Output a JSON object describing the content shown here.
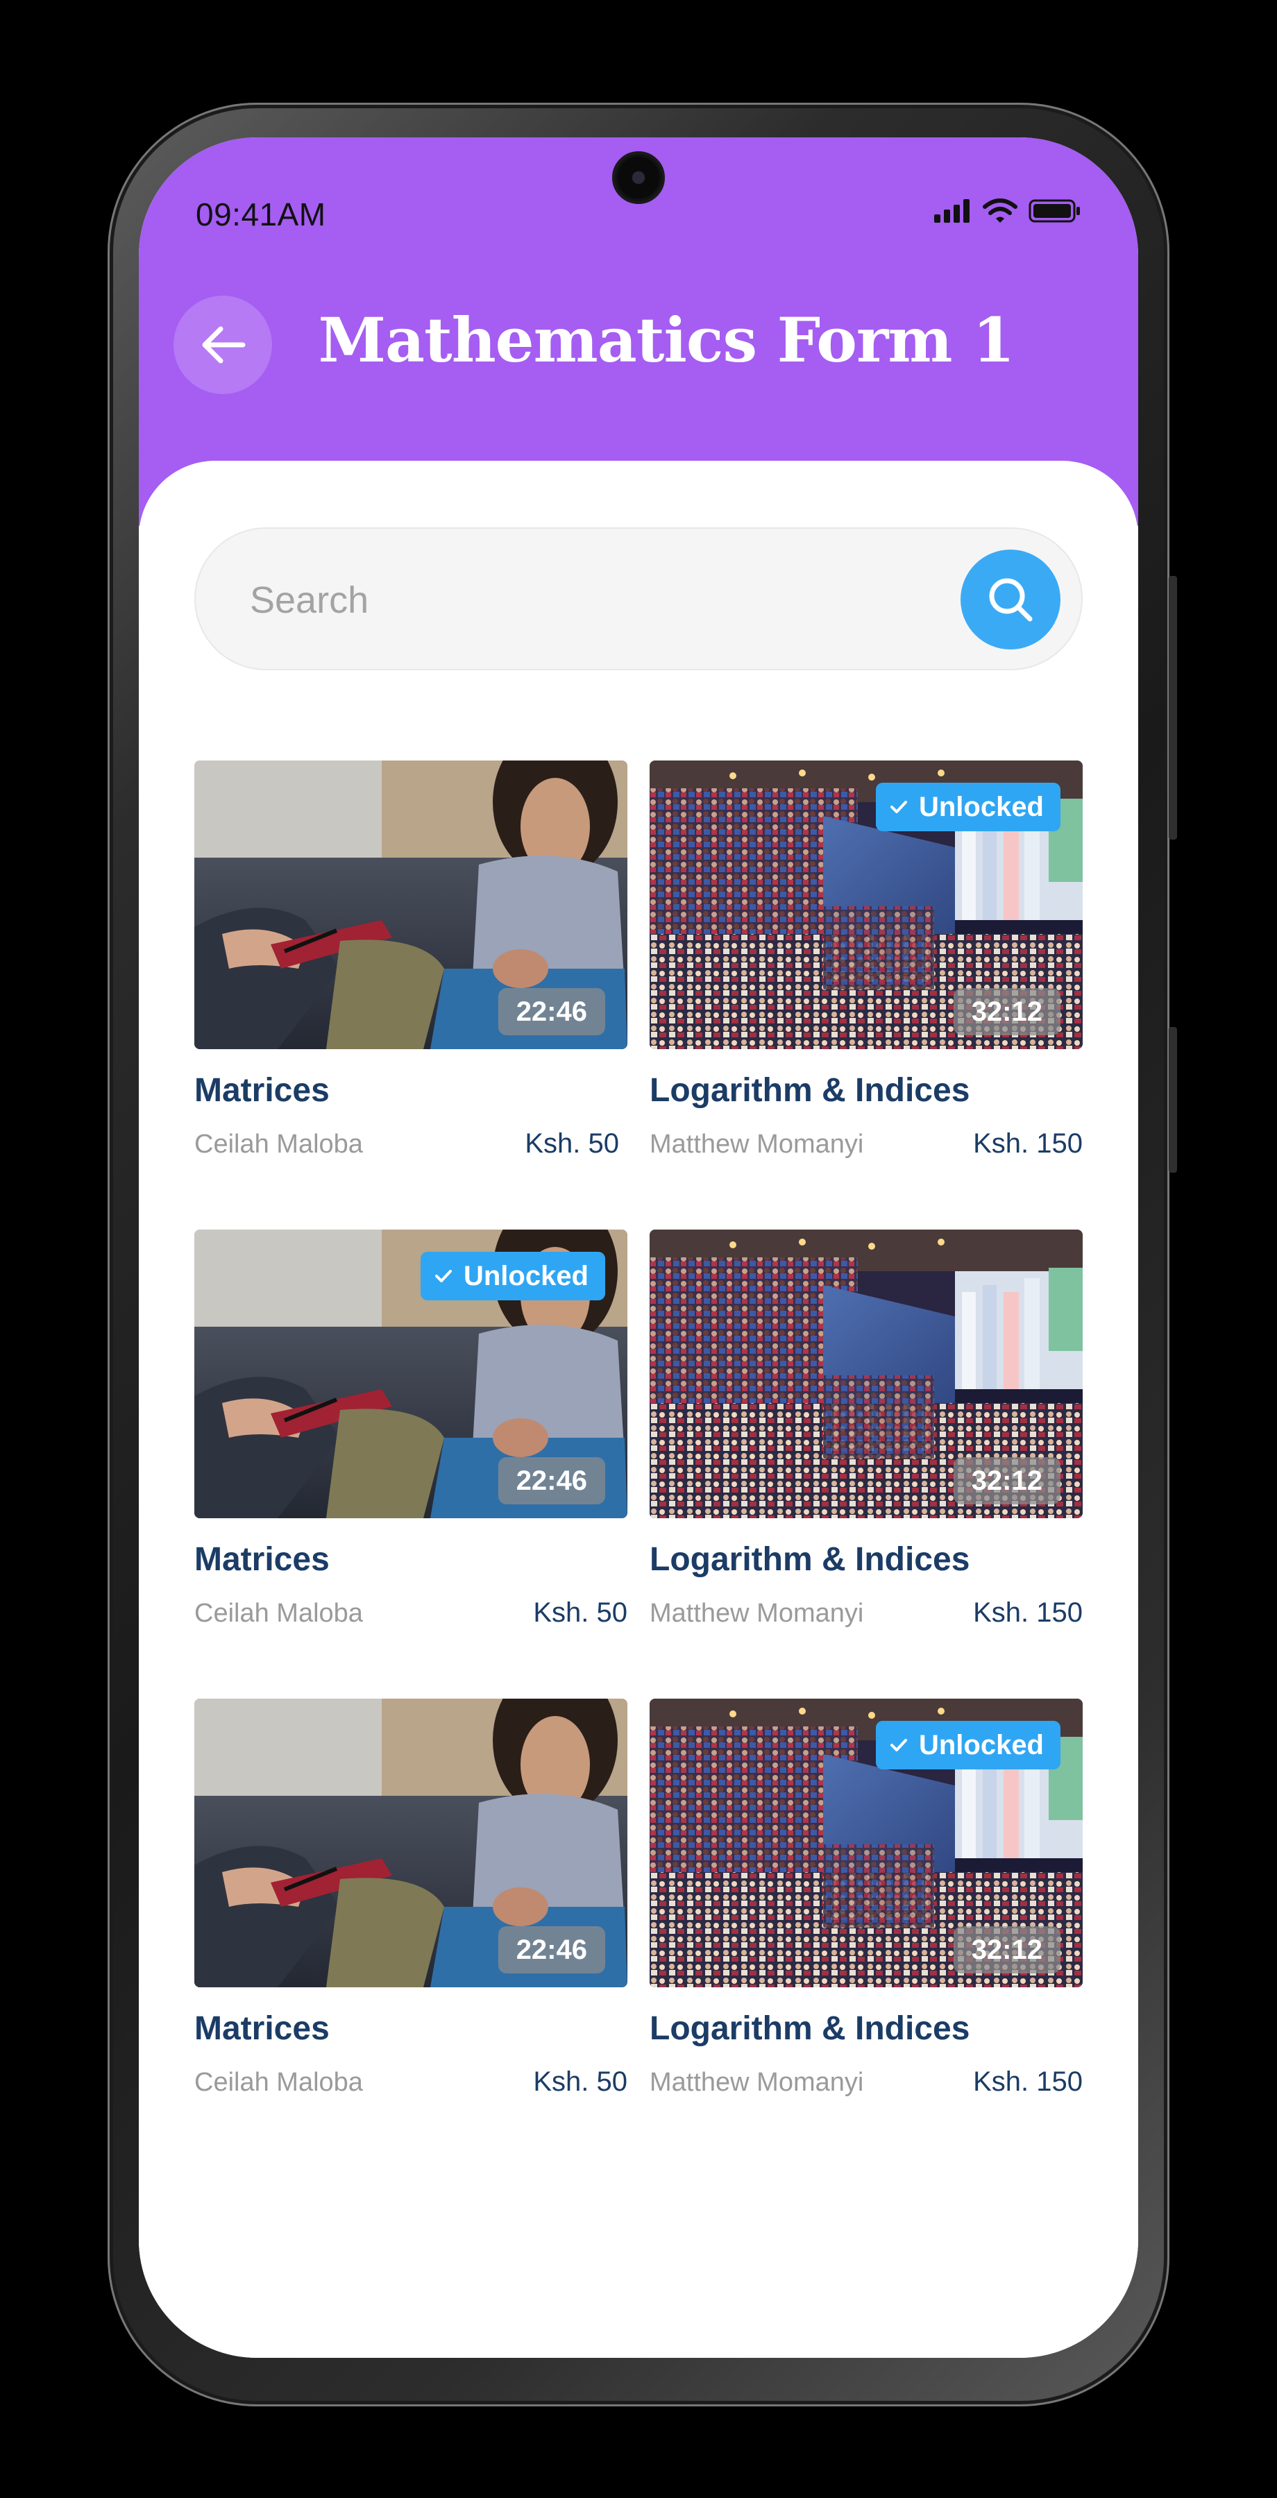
{
  "status_bar": {
    "time": "09:41AM"
  },
  "header": {
    "title": "Mathematics Form 1"
  },
  "search": {
    "placeholder": "Search"
  },
  "colors": {
    "header": "#a55df2",
    "accent": "#3baaf5",
    "title_text": "#1b3c66",
    "muted_text": "#9a9a9a"
  },
  "courses": [
    {
      "title": "Matrices",
      "author": "Ceilah Maloba",
      "price": "Ksh. 50",
      "duration": "22:46",
      "unlocked": false,
      "badge": "",
      "thumbnail": "counseling-session"
    },
    {
      "title": "Logarithm & Indices",
      "author": "Matthew Momanyi",
      "price": "Ksh. 150",
      "duration": "32:12",
      "unlocked": true,
      "badge": "Unlocked",
      "thumbnail": "auditorium-conference"
    },
    {
      "title": "Matrices",
      "author": "Ceilah Maloba",
      "price": "Ksh. 50",
      "duration": "22:46",
      "unlocked": true,
      "badge": "Unlocked",
      "thumbnail": "counseling-session"
    },
    {
      "title": "Logarithm & Indices",
      "author": "Matthew Momanyi",
      "price": "Ksh. 150",
      "duration": "32:12",
      "unlocked": false,
      "badge": "",
      "thumbnail": "auditorium-conference"
    },
    {
      "title": "Matrices",
      "author": "Ceilah Maloba",
      "price": "Ksh. 50",
      "duration": "22:46",
      "unlocked": false,
      "badge": "",
      "thumbnail": "counseling-session"
    },
    {
      "title": "Logarithm & Indices",
      "author": "Matthew Momanyi",
      "price": "Ksh. 150",
      "duration": "32:12",
      "unlocked": true,
      "badge": "Unlocked",
      "thumbnail": "auditorium-conference"
    }
  ]
}
